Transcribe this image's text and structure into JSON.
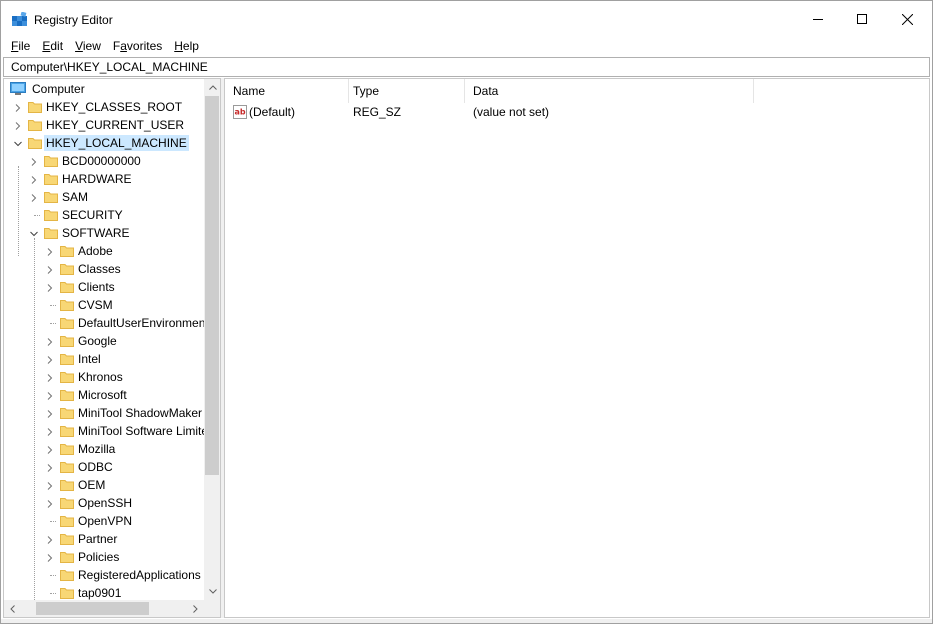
{
  "window": {
    "title": "Registry Editor",
    "icon": "registry-editor-icon"
  },
  "menu": {
    "items": [
      {
        "label_u": "F",
        "label_rest": "ile"
      },
      {
        "label_u": "E",
        "label_rest": "dit"
      },
      {
        "label_u": "V",
        "label_rest": "iew"
      },
      {
        "label_pre": "F",
        "label_u": "a",
        "label_rest": "vorites"
      },
      {
        "label_u": "H",
        "label_rest": "elp"
      }
    ]
  },
  "address": {
    "path": "Computer\\HKEY_LOCAL_MACHINE"
  },
  "tree": {
    "root": "Computer",
    "hives": [
      {
        "label": "HKEY_CLASSES_ROOT",
        "expanded": false
      },
      {
        "label": "HKEY_CURRENT_USER",
        "expanded": false
      },
      {
        "label": "HKEY_LOCAL_MACHINE",
        "expanded": true,
        "selected": true
      }
    ],
    "hklm_children": [
      {
        "label": "BCD00000000",
        "has_children": true
      },
      {
        "label": "HARDWARE",
        "has_children": true
      },
      {
        "label": "SAM",
        "has_children": true
      },
      {
        "label": "SECURITY",
        "has_children": false
      },
      {
        "label": "SOFTWARE",
        "has_children": true,
        "expanded": true
      }
    ],
    "software_children": [
      {
        "label": "Adobe",
        "has_children": true
      },
      {
        "label": "Classes",
        "has_children": true
      },
      {
        "label": "Clients",
        "has_children": true
      },
      {
        "label": "CVSM",
        "has_children": false
      },
      {
        "label": "DefaultUserEnvironment",
        "has_children": false
      },
      {
        "label": "Google",
        "has_children": true
      },
      {
        "label": "Intel",
        "has_children": true
      },
      {
        "label": "Khronos",
        "has_children": true
      },
      {
        "label": "Microsoft",
        "has_children": true
      },
      {
        "label": "MiniTool ShadowMaker",
        "has_children": true
      },
      {
        "label": "MiniTool Software Limited",
        "has_children": true
      },
      {
        "label": "Mozilla",
        "has_children": true
      },
      {
        "label": "ODBC",
        "has_children": true
      },
      {
        "label": "OEM",
        "has_children": true
      },
      {
        "label": "OpenSSH",
        "has_children": true
      },
      {
        "label": "OpenVPN",
        "has_children": false
      },
      {
        "label": "Partner",
        "has_children": true
      },
      {
        "label": "Policies",
        "has_children": true
      },
      {
        "label": "RegisteredApplications",
        "has_children": false
      },
      {
        "label": "tap0901",
        "has_children": false
      }
    ]
  },
  "list": {
    "columns": [
      "Name",
      "Type",
      "Data"
    ],
    "rows": [
      {
        "name": "(Default)",
        "type": "REG_SZ",
        "data": "(value not set)",
        "icon": "string-value-icon"
      }
    ]
  },
  "colors": {
    "selection": "#cce8ff",
    "folder": "#f8d775",
    "folder_dark": "#e4b545"
  }
}
